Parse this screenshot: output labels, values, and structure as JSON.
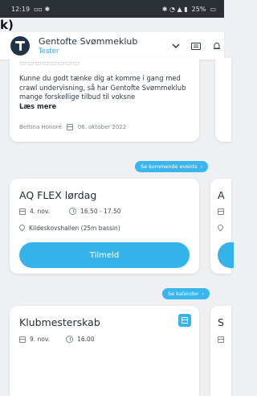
{
  "status_bar": {
    "time": "12:19",
    "battery": "25%"
  },
  "overlay_text": "k)",
  "header": {
    "club_name": "Gentofte Svømmeklub",
    "subtitle": "Tester"
  },
  "news": {
    "body": "Kunne du godt tænke dig at komme i gang med crawl undervisning, så har Gentofte Svømmeklub mange forskellige tilbud til voksne",
    "more_label": "Læs mere",
    "author": "Bettina Honoré",
    "date": "06. oktober 2022"
  },
  "events_link": {
    "label": "Se kommende events"
  },
  "event": {
    "title": "AQ FLEX lørdag",
    "date": "4. nov.",
    "time": "16.50 - 17.50",
    "location": "Kildeskovshallen (25m bassin)",
    "signup_label": "Tilmeld",
    "peek_title": "A"
  },
  "calendar_link": {
    "label": "Se kalender"
  },
  "calendar_event": {
    "title": "Klubmesterskab",
    "date": "9. nov.",
    "time": "16.00",
    "peek_title": "S"
  },
  "colors": {
    "accent": "#35b4ec",
    "navy": "#1f3547",
    "background": "#eef0f3"
  }
}
